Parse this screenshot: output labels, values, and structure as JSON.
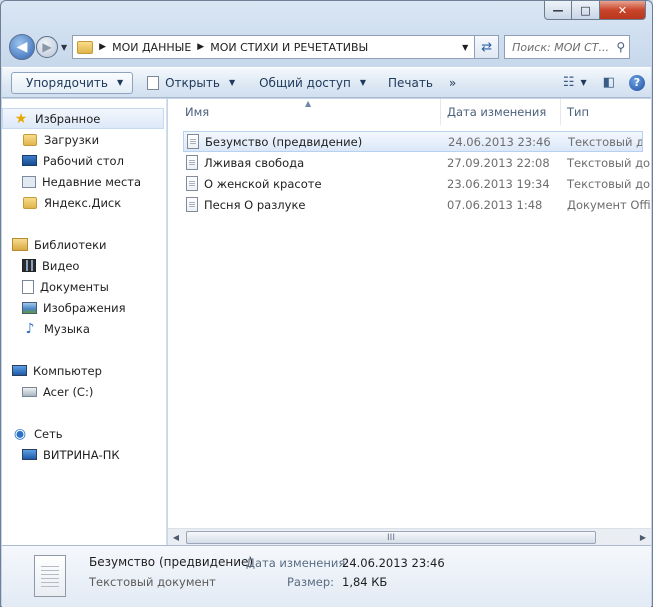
{
  "window": {
    "minimize_glyph": "—",
    "maximize_glyph": "□",
    "close_glyph": "✕"
  },
  "address": {
    "crumbs": [
      "МОИ ДАННЫЕ",
      "МОИ СТИХИ И РЕЧЕТАТИВЫ"
    ],
    "search_placeholder": "Поиск: МОИ СТ..."
  },
  "toolbar": {
    "organize": "Упорядочить",
    "open": "Открыть",
    "share": "Общий доступ",
    "print": "Печать",
    "more": "»",
    "help": "?"
  },
  "sidebar": {
    "favorites": "Избранное",
    "downloads": "Загрузки",
    "desktop": "Рабочий стол",
    "recent": "Недавние места",
    "yandex": "Яндекс.Диск",
    "libraries": "Библиотеки",
    "video": "Видео",
    "documents": "Документы",
    "images": "Изображения",
    "music": "Музыка",
    "computer": "Компьютер",
    "drive": "Acer (C:)",
    "network": "Сеть",
    "net_pc": "ВИТРИНА-ПК"
  },
  "columns": {
    "name": "Имя",
    "date": "Дата изменения",
    "type": "Тип"
  },
  "files": [
    {
      "name": "Безумство (предвидение)",
      "date": "24.06.2013 23:46",
      "type": "Текстовый документ"
    },
    {
      "name": "Лживая свобода",
      "date": "27.09.2013 22:08",
      "type": "Текстовый документ"
    },
    {
      "name": "О женской красоте",
      "date": "23.06.2013 19:34",
      "type": "Текстовый документ"
    },
    {
      "name": "Песня О разлуке",
      "date": "07.06.2013 1:48",
      "type": "Документ Office"
    }
  ],
  "scroll_thumb_grip": "III",
  "details": {
    "name": "Безумство (предвидение)",
    "type": "Текстовый документ",
    "modified_label": "Дата изменения:",
    "modified_value": "24.06.2013 23:46",
    "size_label": "Размер:",
    "size_value": "1,84 КБ"
  }
}
